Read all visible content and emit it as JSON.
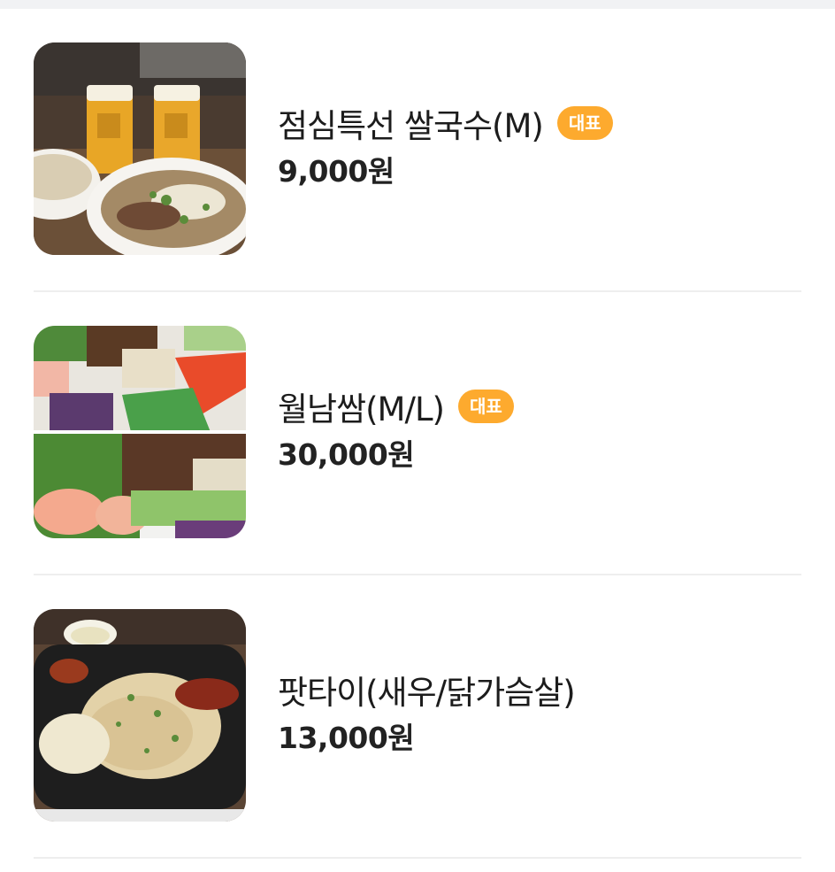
{
  "menu": {
    "items": [
      {
        "name": "점심특선 쌀국수(M)",
        "badge": "대표",
        "price": "9,000원",
        "photo": "pho-noodle-soup-with-beer"
      },
      {
        "name": "월남쌈(M/L)",
        "badge": "대표",
        "price": "30,000원",
        "photo": "spring-roll-vegetable-platter"
      },
      {
        "name": "팟타이(새우/닭가슴살)",
        "badge": "",
        "price": "13,000원",
        "photo": "pad-thai-stir-fried-noodles"
      }
    ]
  }
}
